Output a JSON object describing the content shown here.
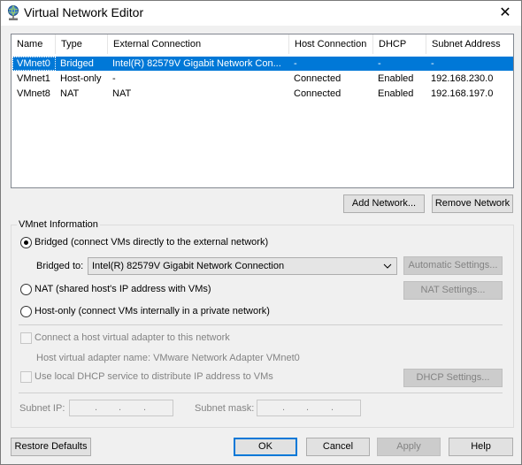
{
  "window": {
    "title": "Virtual Network Editor",
    "close_glyph": "✕",
    "icon": "network-globe-icon"
  },
  "network_list": {
    "columns": [
      "Name",
      "Type",
      "External Connection",
      "Host Connection",
      "DHCP",
      "Subnet Address"
    ],
    "rows": [
      {
        "name": "VMnet0",
        "type": "Bridged",
        "external": "Intel(R) 82579V Gigabit Network Con...",
        "host": "-",
        "dhcp": "-",
        "subnet": "-",
        "selected": true
      },
      {
        "name": "VMnet1",
        "type": "Host-only",
        "external": "-",
        "host": "Connected",
        "dhcp": "Enabled",
        "subnet": "192.168.230.0",
        "selected": false
      },
      {
        "name": "VMnet8",
        "type": "NAT",
        "external": "NAT",
        "host": "Connected",
        "dhcp": "Enabled",
        "subnet": "192.168.197.0",
        "selected": false
      }
    ]
  },
  "list_buttons": {
    "add_network": "Add Network...",
    "remove_network": "Remove Network"
  },
  "vmnet_info": {
    "group_label": "VMnet Information",
    "bridged_label": "Bridged (connect VMs directly to the external network)",
    "bridged_to_label": "Bridged to:",
    "bridged_to_value": "Intel(R) 82579V Gigabit Network Connection",
    "automatic_settings": "Automatic Settings...",
    "nat_label": "NAT (shared host's IP address with VMs)",
    "nat_settings": "NAT Settings...",
    "hostonly_label": "Host-only (connect VMs internally in a private network)",
    "connect_adapter_label": "Connect a host virtual adapter to this network",
    "adapter_name_label": "Host virtual adapter name: VMware Network Adapter VMnet0",
    "dhcp_label": "Use local DHCP service to distribute IP address to VMs",
    "dhcp_settings": "DHCP Settings...",
    "subnet_ip_label": "Subnet IP:",
    "subnet_mask_label": "Subnet mask:",
    "ip_dots": "."
  },
  "footer": {
    "restore_defaults": "Restore Defaults",
    "ok": "OK",
    "cancel": "Cancel",
    "apply": "Apply",
    "help": "Help"
  }
}
